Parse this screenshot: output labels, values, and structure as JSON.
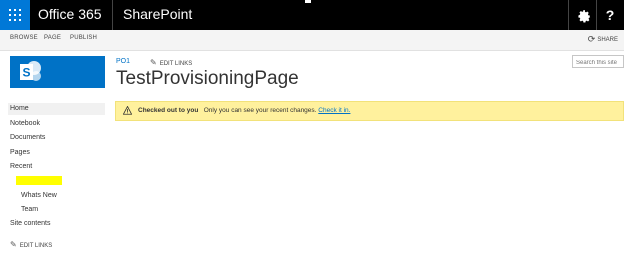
{
  "suite_bar": {
    "brand": "Office 365",
    "app_name": "SharePoint",
    "help_label": "?",
    "waffle_color": "#0078d7"
  },
  "ribbon": {
    "tabs": [
      "BROWSE",
      "PAGE",
      "PUBLISH"
    ],
    "share_label": "SHARE"
  },
  "site": {
    "logo_color": "#0072c6",
    "breadcrumb": "PO1",
    "edit_links": "EDIT LINKS",
    "page_title": "TestProvisioningPage",
    "search_placeholder": "Search this site"
  },
  "status": {
    "bold": "Checked out to you",
    "message": "Only you can see your recent changes.",
    "link": "Check it in.",
    "background": "#fff19d"
  },
  "nav": {
    "home": "Home",
    "notebook": "Notebook",
    "documents": "Documents",
    "pages": "Pages",
    "recent": "Recent",
    "whats_new": "Whats New",
    "team": "Team",
    "site_contents": "Site contents",
    "edit_links": "EDIT LINKS"
  },
  "icons": {
    "waffle": "app-launcher-icon",
    "settings": "gear-icon",
    "help": "help-icon",
    "share": "share-icon",
    "warning": "warning-icon",
    "edit": "pencil-icon"
  }
}
